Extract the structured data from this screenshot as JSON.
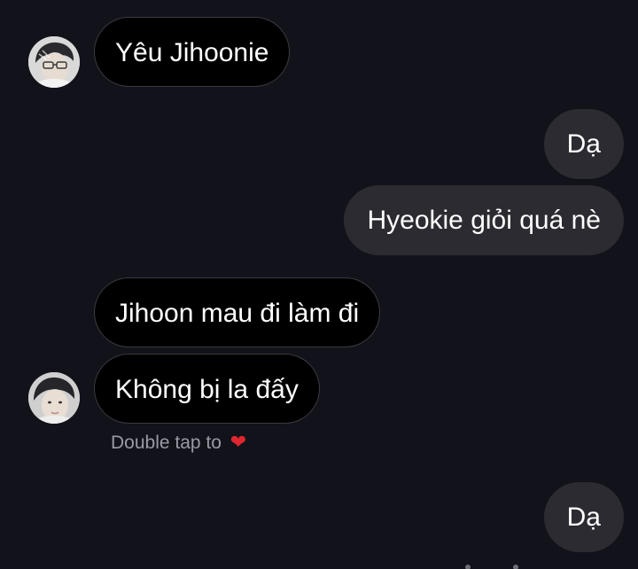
{
  "messages": [
    {
      "sender": "other",
      "text": "Yêu Jihoonie"
    },
    {
      "sender": "me",
      "text": "Dạ"
    },
    {
      "sender": "me",
      "text": "Hyeokie giỏi quá nè"
    },
    {
      "sender": "other",
      "text": "Jihoon mau đi làm đi"
    },
    {
      "sender": "other",
      "text": "Không bị la đấy"
    },
    {
      "sender": "me",
      "text": "Dạ"
    }
  ],
  "reaction_hint": {
    "text": "Double tap to",
    "icon": "heart-icon",
    "glyph": "❤"
  },
  "colors": {
    "background": "#12121a",
    "incoming_bubble": "#000000",
    "outgoing_bubble": "#2b2b31",
    "heart": "#e0262f"
  }
}
